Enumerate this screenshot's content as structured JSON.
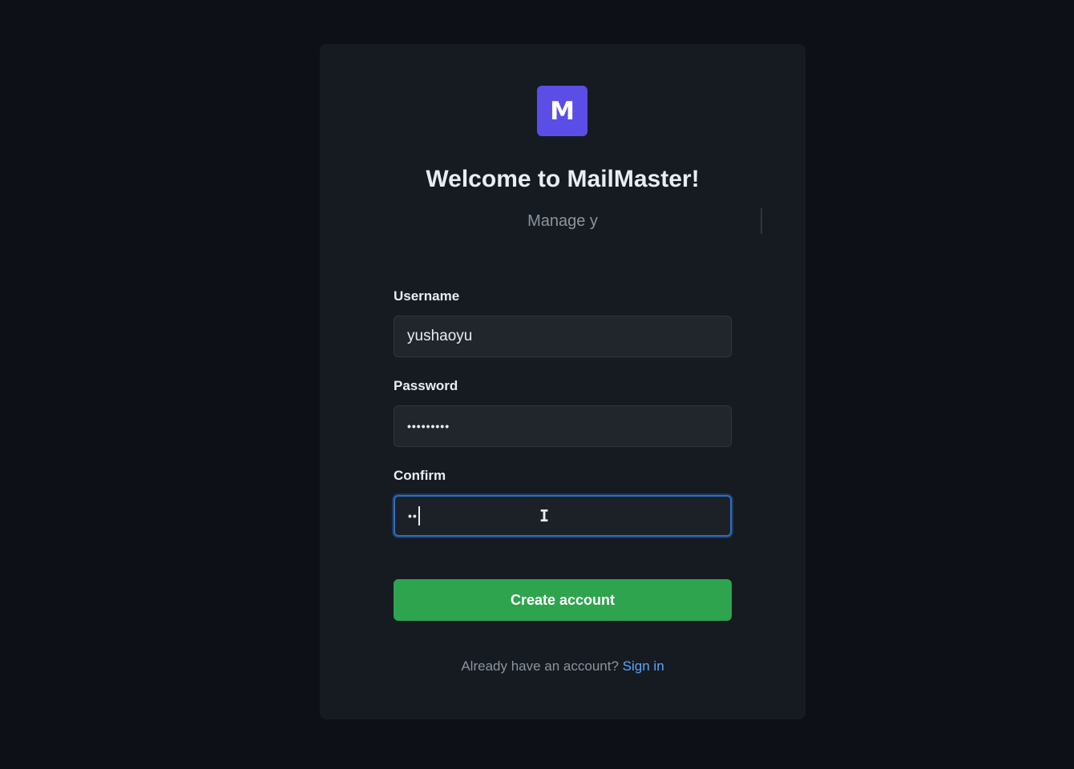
{
  "brand": {
    "logo_letter": "M",
    "accent_color": "#5b4ee6"
  },
  "header": {
    "title": "Welcome to MailMaster!",
    "subtitle": "Manage y"
  },
  "form": {
    "username": {
      "label": "Username",
      "value": "yushaoyu"
    },
    "password": {
      "label": "Password",
      "value": "•••••••••"
    },
    "confirm": {
      "label": "Confirm",
      "value": "••",
      "focused": true
    },
    "submit_label": "Create account",
    "submit_color": "#2ea44f"
  },
  "footer": {
    "prompt": "Already have an account?",
    "link_label": "Sign in",
    "link_color": "#58a6ff"
  }
}
